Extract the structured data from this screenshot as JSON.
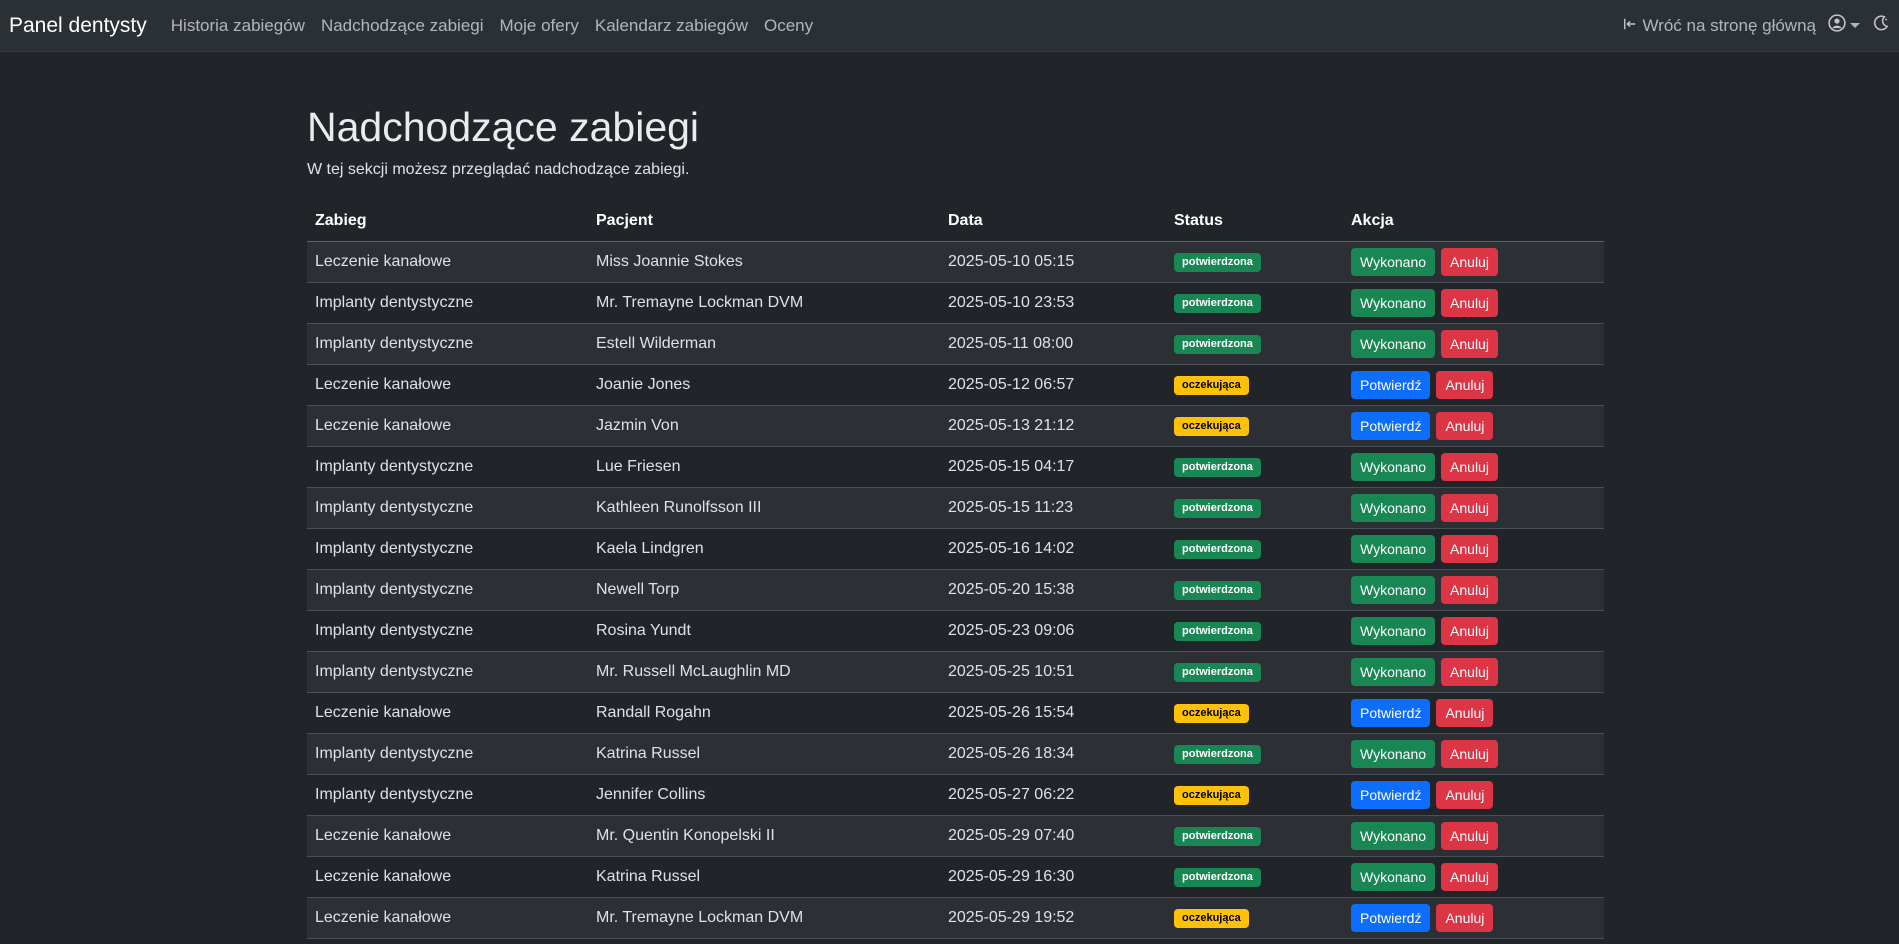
{
  "nav": {
    "brand": "Panel dentysty",
    "links": [
      "Historia zabiegów",
      "Nadchodzące zabiegi",
      "Moje ofery",
      "Kalendarz zabiegów",
      "Oceny"
    ],
    "back_label": "Wróć na stronę główną"
  },
  "page": {
    "title": "Nadchodzące zabiegi",
    "description": "W tej sekcji możesz przeglądać nadchodzące zabiegi."
  },
  "table": {
    "headers": [
      "Zabieg",
      "Pacjent",
      "Data",
      "Status",
      "Akcja"
    ],
    "rows": [
      {
        "procedure": "Leczenie kanałowe",
        "patient": "Miss Joannie Stokes",
        "date": "2025-05-10 05:15",
        "status": "potwierdzona",
        "action": "Wykonano"
      },
      {
        "procedure": "Implanty dentystyczne",
        "patient": "Mr. Tremayne Lockman DVM",
        "date": "2025-05-10 23:53",
        "status": "potwierdzona",
        "action": "Wykonano"
      },
      {
        "procedure": "Implanty dentystyczne",
        "patient": "Estell Wilderman",
        "date": "2025-05-11 08:00",
        "status": "potwierdzona",
        "action": "Wykonano"
      },
      {
        "procedure": "Leczenie kanałowe",
        "patient": "Joanie Jones",
        "date": "2025-05-12 06:57",
        "status": "oczekująca",
        "action": "Potwierdź"
      },
      {
        "procedure": "Leczenie kanałowe",
        "patient": "Jazmin Von",
        "date": "2025-05-13 21:12",
        "status": "oczekująca",
        "action": "Potwierdź"
      },
      {
        "procedure": "Implanty dentystyczne",
        "patient": "Lue Friesen",
        "date": "2025-05-15 04:17",
        "status": "potwierdzona",
        "action": "Wykonano"
      },
      {
        "procedure": "Implanty dentystyczne",
        "patient": "Kathleen Runolfsson III",
        "date": "2025-05-15 11:23",
        "status": "potwierdzona",
        "action": "Wykonano"
      },
      {
        "procedure": "Implanty dentystyczne",
        "patient": "Kaela Lindgren",
        "date": "2025-05-16 14:02",
        "status": "potwierdzona",
        "action": "Wykonano"
      },
      {
        "procedure": "Implanty dentystyczne",
        "patient": "Newell Torp",
        "date": "2025-05-20 15:38",
        "status": "potwierdzona",
        "action": "Wykonano"
      },
      {
        "procedure": "Implanty dentystyczne",
        "patient": "Rosina Yundt",
        "date": "2025-05-23 09:06",
        "status": "potwierdzona",
        "action": "Wykonano"
      },
      {
        "procedure": "Implanty dentystyczne",
        "patient": "Mr. Russell McLaughlin MD",
        "date": "2025-05-25 10:51",
        "status": "potwierdzona",
        "action": "Wykonano"
      },
      {
        "procedure": "Leczenie kanałowe",
        "patient": "Randall Rogahn",
        "date": "2025-05-26 15:54",
        "status": "oczekująca",
        "action": "Potwierdź"
      },
      {
        "procedure": "Implanty dentystyczne",
        "patient": "Katrina Russel",
        "date": "2025-05-26 18:34",
        "status": "potwierdzona",
        "action": "Wykonano"
      },
      {
        "procedure": "Implanty dentystyczne",
        "patient": "Jennifer Collins",
        "date": "2025-05-27 06:22",
        "status": "oczekująca",
        "action": "Potwierdź"
      },
      {
        "procedure": "Leczenie kanałowe",
        "patient": "Mr. Quentin Konopelski II",
        "date": "2025-05-29 07:40",
        "status": "potwierdzona",
        "action": "Wykonano"
      },
      {
        "procedure": "Leczenie kanałowe",
        "patient": "Katrina Russel",
        "date": "2025-05-29 16:30",
        "status": "potwierdzona",
        "action": "Wykonano"
      },
      {
        "procedure": "Leczenie kanałowe",
        "patient": "Mr. Tremayne Lockman DVM",
        "date": "2025-05-29 19:52",
        "status": "oczekująca",
        "action": "Potwierdź"
      }
    ],
    "cancel_label": "Anuluj"
  },
  "colors": {
    "background": "#212529",
    "navbar": "#2b3035",
    "success": "#198754",
    "primary": "#0d6efd",
    "danger": "#dc3545",
    "warning": "#ffc107"
  },
  "icons": [
    "box-arrow-left-icon",
    "user-circle-icon",
    "theme-moon-icon"
  ]
}
